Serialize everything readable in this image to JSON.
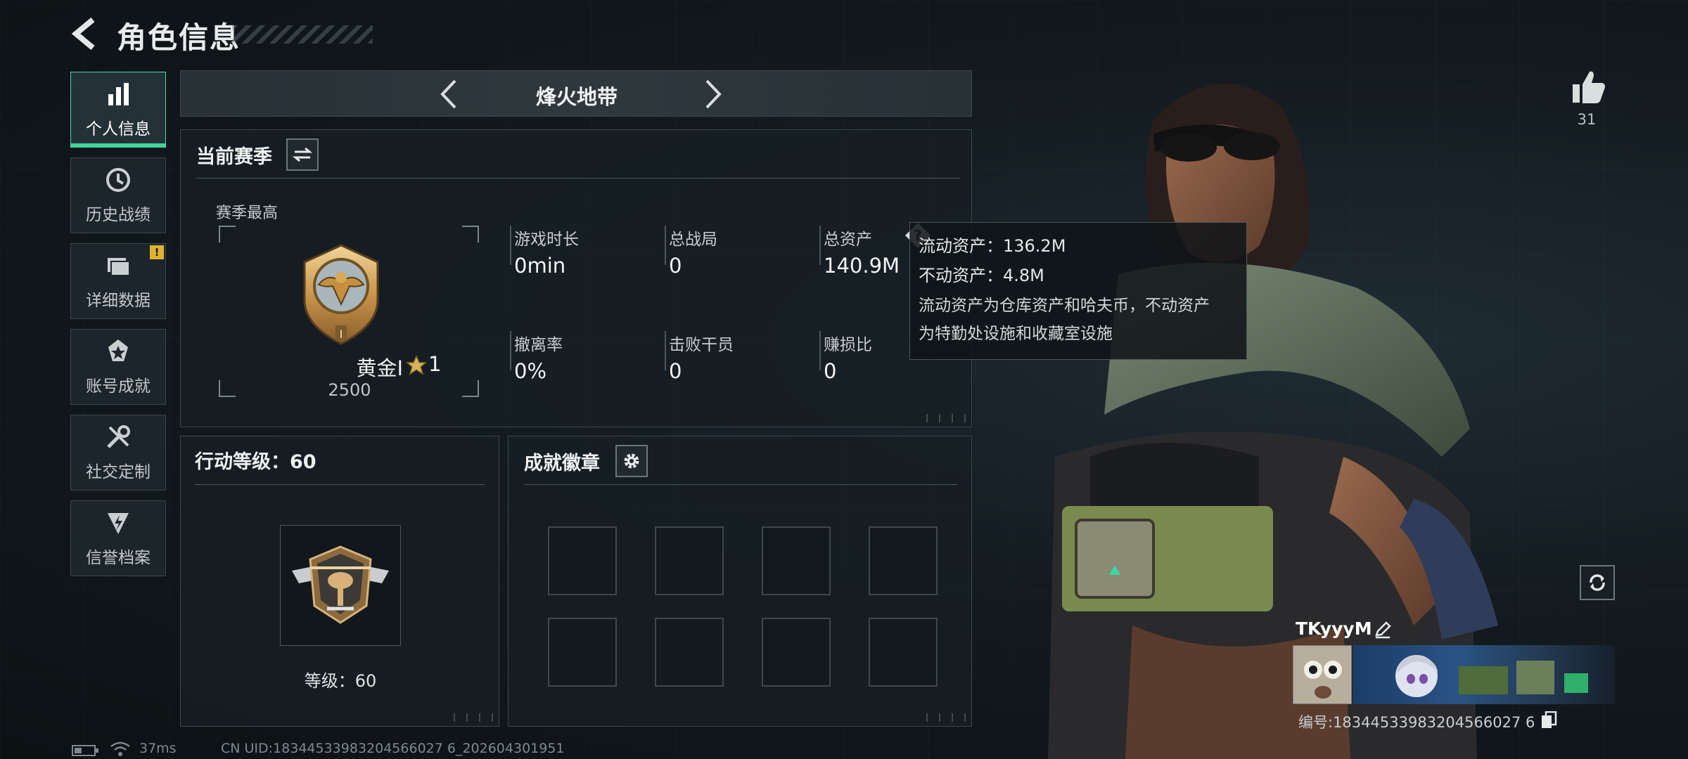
{
  "header": {
    "title": "角色信息"
  },
  "sidebar": {
    "items": [
      {
        "label": "个人信息",
        "icon": "bar-chart-icon",
        "active": true
      },
      {
        "label": "历史战绩",
        "icon": "history-clock-icon"
      },
      {
        "label": "详细数据",
        "icon": "folder-icon",
        "badge": "!"
      },
      {
        "label": "账号成就",
        "icon": "achievement-star-icon"
      },
      {
        "label": "社交定制",
        "icon": "wrench-tools-icon"
      },
      {
        "label": "信誉档案",
        "icon": "reputation-shield-icon"
      }
    ]
  },
  "mode_bar": {
    "title": "烽火地带"
  },
  "season_panel": {
    "title": "当前赛季",
    "best_label": "赛季最高",
    "rank_name": "黄金I",
    "rank_stars": "1",
    "rank_score": "2500",
    "stats": [
      {
        "label": "游戏时长",
        "value": "0min"
      },
      {
        "label": "总战局",
        "value": "0"
      },
      {
        "label": "总资产",
        "value": "140.9M"
      },
      {
        "label": "撤离率",
        "value": "0%"
      },
      {
        "label": "击败干员",
        "value": "0"
      },
      {
        "label": "赚损比",
        "value": "0"
      }
    ]
  },
  "tooltip": {
    "liquid": "流动资产：136.2M",
    "fixed": "不动资产：4.8M",
    "desc_line1": "流动资产为仓库资产和哈夫币，不动资产",
    "desc_line2": "为特勤处设施和收藏室设施"
  },
  "action_panel": {
    "title": "行动等级：60",
    "level_text": "等级：60"
  },
  "badge_panel": {
    "title": "成就徽章",
    "slots": 8
  },
  "profile": {
    "likes": "31",
    "player_name": "TKyyyM",
    "player_id": "编号:18344533983204566027 6"
  },
  "status_bar": {
    "ping": "37ms",
    "uid": "CN UID:18344533983204566027 6_202604301951"
  },
  "colors": {
    "accent": "#42d59b",
    "gold": "#c89a4a",
    "warning": "#e0b030"
  }
}
